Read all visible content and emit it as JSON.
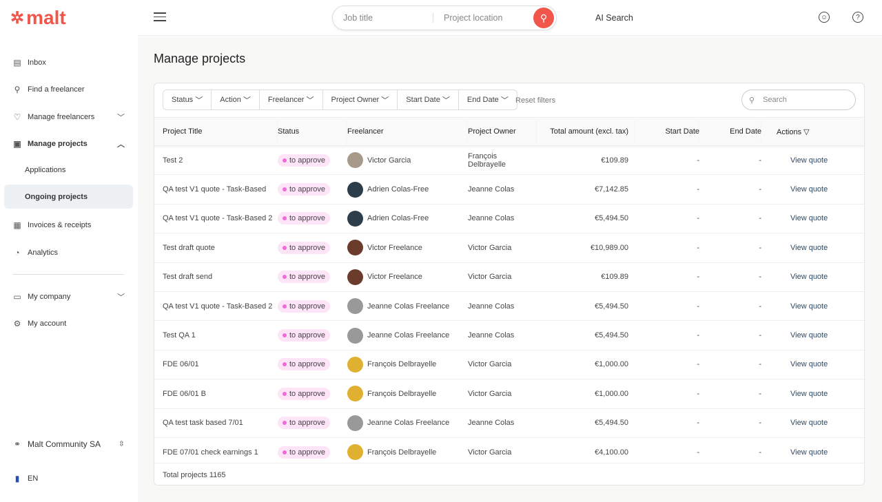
{
  "brand": {
    "name": "malt"
  },
  "sidebar": {
    "items": [
      {
        "label": "Inbox",
        "icon": "inbox-icon"
      },
      {
        "label": "Find a freelancer",
        "icon": "search-person-icon"
      },
      {
        "label": "Manage freelancers",
        "icon": "heart-icon"
      },
      {
        "label": "Manage projects",
        "icon": "clipboard-icon"
      },
      {
        "label": "Applications"
      },
      {
        "label": "Ongoing projects"
      },
      {
        "label": "Invoices & receipts",
        "icon": "invoice-icon"
      },
      {
        "label": "Analytics",
        "icon": "chart-icon"
      },
      {
        "label": "My company",
        "icon": "briefcase-icon"
      },
      {
        "label": "My account",
        "icon": "gear-icon"
      }
    ],
    "company": "Malt Community SA",
    "language": "EN"
  },
  "topbar": {
    "job_placeholder": "Job title",
    "location_placeholder": "Project location",
    "ai_search": "AI Search"
  },
  "page": {
    "title": "Manage projects"
  },
  "filters": [
    "Status",
    "Action",
    "Freelancer",
    "Project Owner",
    "Start Date",
    "End Date"
  ],
  "reset_filters": "Reset filters",
  "search_placeholder": "Search",
  "table": {
    "headers": [
      "Project Title",
      "Status",
      "Freelancer",
      "Project Owner",
      "Total amount (excl. tax)",
      "Start Date",
      "End Date",
      "Actions ▽"
    ],
    "rows": [
      [
        "Test 2",
        "to approve",
        "Victor Garcia",
        "François Delbrayelle",
        "€109.89",
        "-",
        "-",
        "View quote"
      ],
      [
        "QA test V1 quote - Task-Based",
        "to approve",
        "Adrien Colas-Free",
        "Jeanne Colas",
        "€7,142.85",
        "-",
        "-",
        "View quote"
      ],
      [
        "QA test V1 quote - Task-Based 2",
        "to approve",
        "Adrien Colas-Free",
        "Jeanne Colas",
        "€5,494.50",
        "-",
        "-",
        "View quote"
      ],
      [
        "Test draft quote",
        "to approve",
        "Victor Freelance",
        "Victor Garcia",
        "€10,989.00",
        "-",
        "-",
        "View quote"
      ],
      [
        "Test draft send",
        "to approve",
        "Victor Freelance",
        "Victor Garcia",
        "€109.89",
        "-",
        "-",
        "View quote"
      ],
      [
        "QA test V1 quote - Task-Based 2",
        "to approve",
        "Jeanne Colas Freelance",
        "Jeanne Colas",
        "€5,494.50",
        "-",
        "-",
        "View quote"
      ],
      [
        "Test QA 1",
        "to approve",
        "Jeanne Colas Freelance",
        "Jeanne Colas",
        "€5,494.50",
        "-",
        "-",
        "View quote"
      ],
      [
        "FDE 06/01",
        "to approve",
        "François Delbrayelle",
        "Victor Garcia",
        "€1,000.00",
        "-",
        "-",
        "View quote"
      ],
      [
        "FDE 06/01 B",
        "to approve",
        "François Delbrayelle",
        "Victor Garcia",
        "€1,000.00",
        "-",
        "-",
        "View quote"
      ],
      [
        "QA test task based 7/01",
        "to approve",
        "Jeanne Colas Freelance",
        "Jeanne Colas",
        "€5,494.50",
        "-",
        "-",
        "View quote"
      ],
      [
        "FDE 07/01 check earnings 1",
        "to approve",
        "François Delbrayelle",
        "Victor Garcia",
        "€4,100.00",
        "-",
        "-",
        "View quote"
      ]
    ]
  },
  "total": "Total projects 1165"
}
